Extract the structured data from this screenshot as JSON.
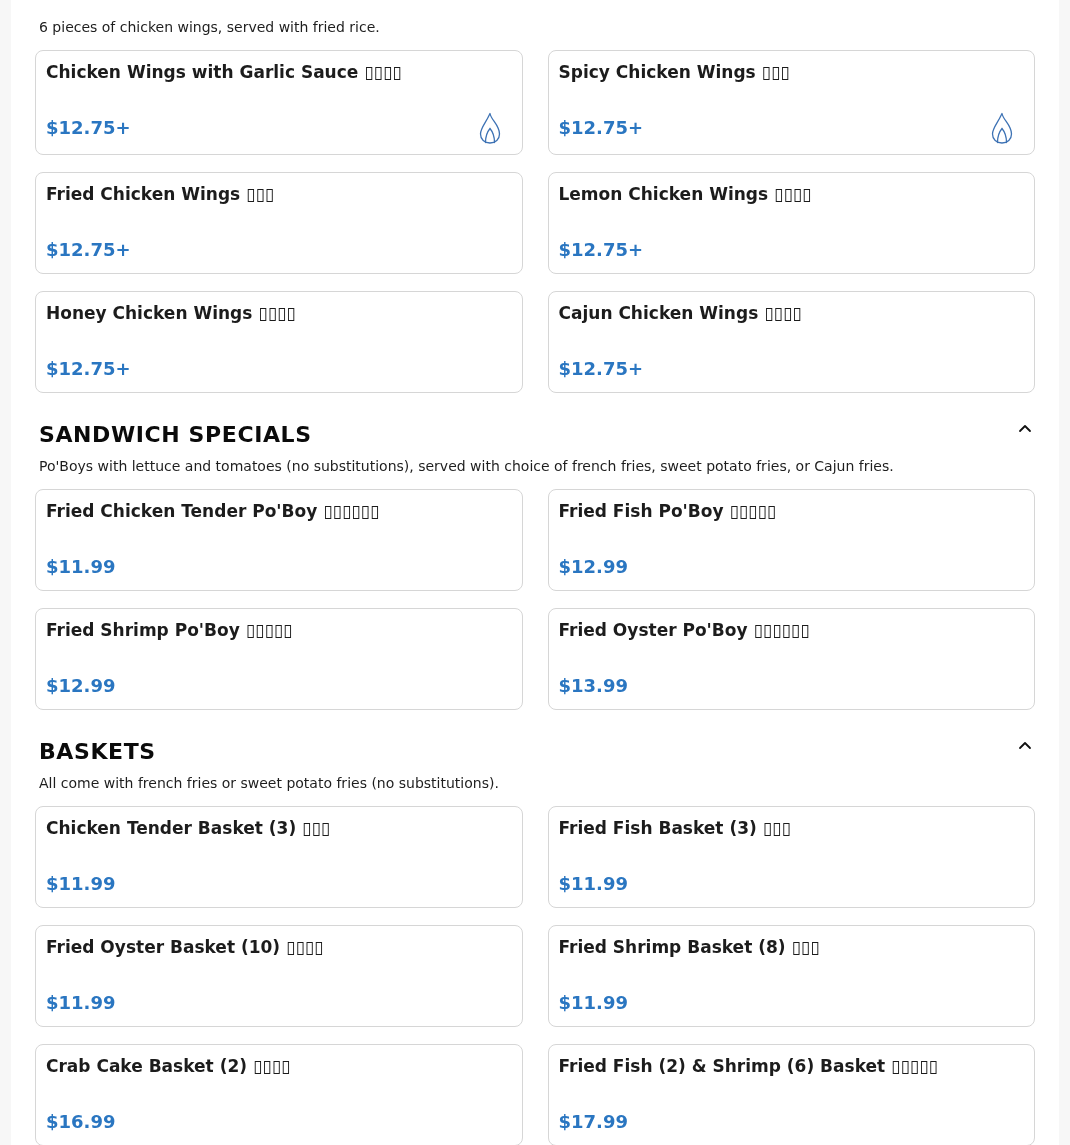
{
  "sections": [
    {
      "description": "6 pieces of chicken wings, served with fried rice.",
      "items": [
        {
          "name": "Chicken Wings with Garlic Sauce ▯▯▯▯",
          "price": "$12.75+",
          "spicy": true
        },
        {
          "name": "Spicy Chicken Wings ▯▯▯",
          "price": "$12.75+",
          "spicy": true
        },
        {
          "name": "Fried Chicken Wings ▯▯▯",
          "price": "$12.75+",
          "spicy": false
        },
        {
          "name": "Lemon Chicken Wings ▯▯▯▯",
          "price": "$12.75+",
          "spicy": false
        },
        {
          "name": "Honey Chicken Wings ▯▯▯▯",
          "price": "$12.75+",
          "spicy": false
        },
        {
          "name": "Cajun Chicken Wings ▯▯▯▯",
          "price": "$12.75+",
          "spicy": false
        }
      ]
    },
    {
      "title": "SANDWICH SPECIALS",
      "expanded": true,
      "description": "Po'Boys with lettuce and tomatoes (no substitutions), served with choice of french fries, sweet potato fries, or Cajun fries.",
      "items": [
        {
          "name": "Fried Chicken Tender Po'Boy ▯▯▯▯▯▯",
          "price": "$11.99",
          "spicy": false
        },
        {
          "name": "Fried Fish Po'Boy ▯▯▯▯▯",
          "price": "$12.99",
          "spicy": false
        },
        {
          "name": "Fried Shrimp Po'Boy ▯▯▯▯▯",
          "price": "$12.99",
          "spicy": false
        },
        {
          "name": "Fried Oyster Po'Boy ▯▯▯▯▯▯",
          "price": "$13.99",
          "spicy": false
        }
      ]
    },
    {
      "title": "BASKETS",
      "expanded": true,
      "description": "All come with french fries or sweet potato fries (no substitutions).",
      "items": [
        {
          "name": "Chicken Tender Basket (3) ▯▯▯",
          "price": "$11.99",
          "spicy": false
        },
        {
          "name": "Fried Fish Basket (3) ▯▯▯",
          "price": "$11.99",
          "spicy": false
        },
        {
          "name": "Fried Oyster Basket (10) ▯▯▯▯",
          "price": "$11.99",
          "spicy": false
        },
        {
          "name": "Fried Shrimp Basket (8) ▯▯▯",
          "price": "$11.99",
          "spicy": false
        },
        {
          "name": "Crab Cake Basket (2) ▯▯▯▯",
          "price": "$16.99",
          "spicy": false
        },
        {
          "name": "Fried Fish (2) & Shrimp (6) Basket ▯▯▯▯▯",
          "price": "$17.99",
          "spicy": false
        }
      ]
    }
  ]
}
